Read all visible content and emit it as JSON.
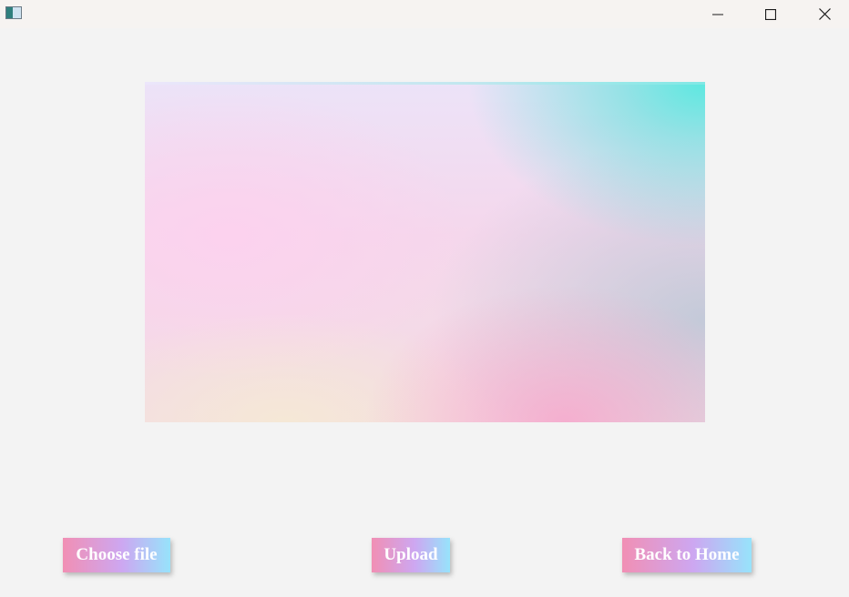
{
  "window": {
    "controls": {
      "minimize_icon": "minimize-icon",
      "maximize_icon": "maximize-icon",
      "close_icon": "close-icon"
    }
  },
  "preview": {
    "colors": [
      "#ece3f8",
      "#f5d7ec",
      "#5ce8e0",
      "#f6aacd",
      "#f5e8d6"
    ]
  },
  "actions": {
    "choose_file_label": "Choose file",
    "upload_label": "Upload",
    "back_home_label": "Back to Home",
    "button_gradient": [
      "#f18fb4",
      "#cda7f1",
      "#97e3fb"
    ]
  }
}
